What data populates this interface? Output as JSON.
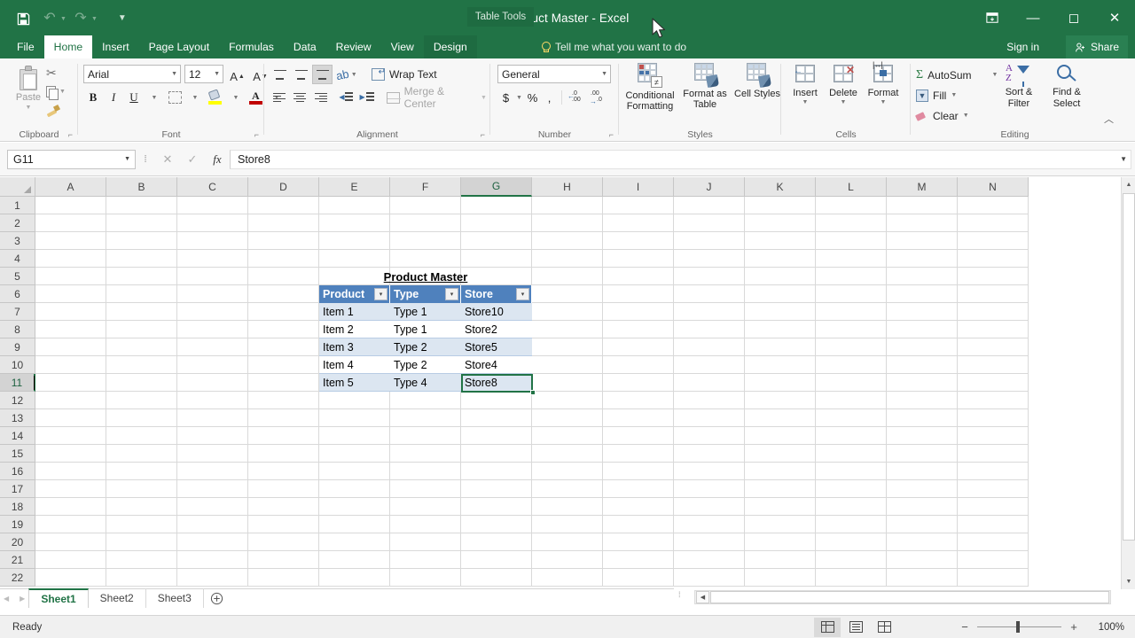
{
  "window": {
    "title": "Product Master - Excel",
    "contextual_tab_group": "Table Tools",
    "signin": "Sign in",
    "share": "Share",
    "minimize": "—",
    "maximize": "◻",
    "close": "✕"
  },
  "quick_access": {
    "save": "save-icon",
    "undo": "undo-icon",
    "redo": "redo-icon",
    "customize": "customize-icon"
  },
  "tabs": [
    {
      "label": "File",
      "active": false
    },
    {
      "label": "Home",
      "active": true
    },
    {
      "label": "Insert",
      "active": false
    },
    {
      "label": "Page Layout",
      "active": false
    },
    {
      "label": "Formulas",
      "active": false
    },
    {
      "label": "Data",
      "active": false
    },
    {
      "label": "Review",
      "active": false
    },
    {
      "label": "View",
      "active": false
    },
    {
      "label": "Design",
      "active": false,
      "contextual": true
    }
  ],
  "tellme": {
    "placeholder": "Tell me what you want to do"
  },
  "ribbon": {
    "groups": [
      {
        "name": "Clipboard"
      },
      {
        "name": "Font"
      },
      {
        "name": "Alignment"
      },
      {
        "name": "Number"
      },
      {
        "name": "Styles"
      },
      {
        "name": "Cells"
      },
      {
        "name": "Editing"
      }
    ],
    "clipboard": {
      "paste": "Paste"
    },
    "font": {
      "font_name": "Arial",
      "font_size": "12",
      "bold": "B",
      "italic": "I",
      "underline": "U"
    },
    "alignment": {
      "wrap_text": "Wrap Text",
      "merge_center": "Merge & Center"
    },
    "number": {
      "format": "General",
      "currency": "$",
      "percent": "%",
      "comma": ","
    },
    "styles": {
      "conditional_formatting": "Conditional Formatting",
      "format_as_table": "Format as Table",
      "cell_styles": "Cell Styles"
    },
    "cells": {
      "insert": "Insert",
      "delete": "Delete",
      "format": "Format"
    },
    "editing": {
      "autosum": "AutoSum",
      "fill": "Fill",
      "clear": "Clear",
      "sort_filter": "Sort & Filter",
      "find_select": "Find & Select"
    }
  },
  "formula_bar": {
    "name_box": "G11",
    "cancel": "✕",
    "enter": "✓",
    "insert_function": "fx",
    "value": "Store8"
  },
  "grid": {
    "columns": [
      "A",
      "B",
      "C",
      "D",
      "E",
      "F",
      "G",
      "H",
      "I",
      "J",
      "K",
      "L",
      "M",
      "N"
    ],
    "selected_column": "G",
    "rows": [
      "1",
      "2",
      "3",
      "4",
      "5",
      "6",
      "7",
      "8",
      "9",
      "10",
      "11",
      "12",
      "13",
      "14",
      "15",
      "16",
      "17",
      "18",
      "19",
      "20",
      "21",
      "22"
    ],
    "selected_row": "11",
    "active_cell": "G11"
  },
  "table": {
    "title": "Product Master",
    "headers": [
      "Product",
      "Type",
      "Store"
    ],
    "filter_icon": "▾",
    "rows": [
      {
        "product": "Item 1",
        "type": "Type 1",
        "store": "Store10"
      },
      {
        "product": "Item 2",
        "type": "Type 1",
        "store": "Store2"
      },
      {
        "product": "Item 3",
        "type": "Type 2",
        "store": "Store5"
      },
      {
        "product": "Item 4",
        "type": "Type 2",
        "store": "Store4"
      },
      {
        "product": "Item 5",
        "type": "Type 4",
        "store": "Store8"
      }
    ],
    "header_color": "#4f81bd",
    "band_color": "#dce6f1",
    "selection_color": "#217346"
  },
  "sheet_tabs": {
    "items": [
      {
        "label": "Sheet1",
        "active": true
      },
      {
        "label": "Sheet2",
        "active": false
      },
      {
        "label": "Sheet3",
        "active": false
      }
    ],
    "add": "+"
  },
  "status_bar": {
    "status": "Ready",
    "zoom": "100%",
    "zoom_out": "−",
    "zoom_in": "+",
    "views": [
      "normal-view",
      "page-layout-view",
      "page-break-view"
    ]
  }
}
